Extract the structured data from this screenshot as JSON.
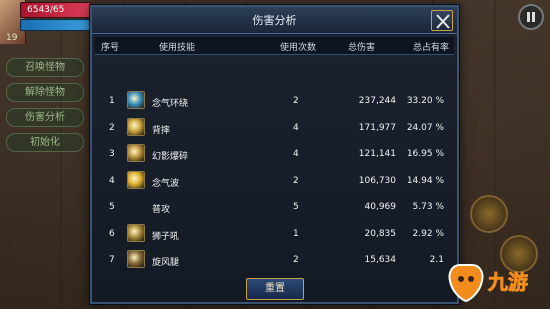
{
  "hud": {
    "hp_text": "6543/65",
    "level": "19"
  },
  "side_menu": [
    {
      "label": "召唤怪物"
    },
    {
      "label": "解除怪物"
    },
    {
      "label": "伤害分析"
    },
    {
      "label": "初始化"
    }
  ],
  "dialog": {
    "title": "伤害分析",
    "columns": {
      "index": "序号",
      "skill": "使用技能",
      "times": "使用次数",
      "total_damage": "总伤害",
      "total_share": "总占有率"
    },
    "rows": [
      {
        "index": "1",
        "skill": "念气环绕",
        "icon": "aura-orb-icon",
        "icon_color": "#3a8fbf",
        "times": "2",
        "damage": "237,244",
        "share": "33.20 %"
      },
      {
        "index": "2",
        "skill": "背摔",
        "icon": "throw-icon",
        "icon_color": "#c9a23a",
        "times": "4",
        "damage": "171,977",
        "share": "24.07 %"
      },
      {
        "index": "3",
        "skill": "幻影爆碎",
        "icon": "phantom-burst-icon",
        "icon_color": "#b8903a",
        "times": "4",
        "damage": "121,141",
        "share": "16.95 %"
      },
      {
        "index": "4",
        "skill": "念气波",
        "icon": "energy-wave-icon",
        "icon_color": "#e0b030",
        "times": "2",
        "damage": "106,730",
        "share": "14.94 %"
      },
      {
        "index": "5",
        "skill": "普攻",
        "icon": "",
        "icon_color": "",
        "times": "5",
        "damage": "40,969",
        "share": "5.73 %"
      },
      {
        "index": "6",
        "skill": "狮子吼",
        "icon": "lion-roar-icon",
        "icon_color": "#a88a3a",
        "times": "1",
        "damage": "20,835",
        "share": "2.92 %"
      },
      {
        "index": "7",
        "skill": "旋风腿",
        "icon": "whirlwind-kick-icon",
        "icon_color": "#8a6a3a",
        "times": "2",
        "damage": "15,634",
        "share": "2.1"
      }
    ],
    "reset_label": "重置"
  },
  "watermark": {
    "text": "九游"
  }
}
